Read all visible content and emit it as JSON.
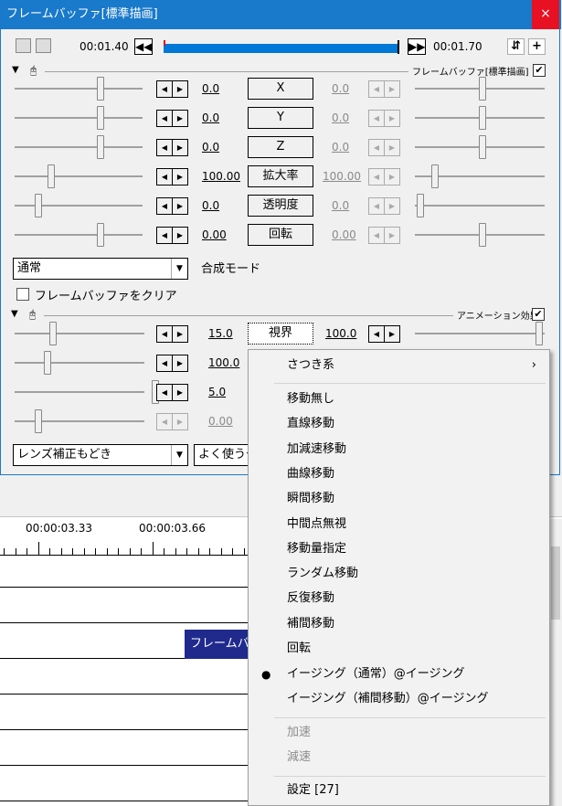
{
  "window": {
    "title": "フレームバッファ[標準描画]",
    "close_glyph": "×"
  },
  "toolbar": {
    "current_time": "00:01.40",
    "end_time": "00:01.70",
    "prev_glyph": "◀◀",
    "next_glyph": "▶▶",
    "right_btn1": "⇵",
    "right_btn2": "+"
  },
  "section1": {
    "label": "フレームバッファ[標準描画]",
    "checked": "✔"
  },
  "params": [
    {
      "left": "0.0",
      "button": "X",
      "right": "0.0"
    },
    {
      "left": "0.0",
      "button": "Y",
      "right": "0.0"
    },
    {
      "left": "0.0",
      "button": "Z",
      "right": "0.0"
    },
    {
      "left": "100.00",
      "button": "拡大率",
      "right": "100.00"
    },
    {
      "left": "0.0",
      "button": "透明度",
      "right": "0.0"
    },
    {
      "left": "0.00",
      "button": "回転",
      "right": "0.00"
    }
  ],
  "blend": {
    "value": "通常",
    "label": "合成モード"
  },
  "clear_buffer": {
    "label": "フレームバッファをクリア"
  },
  "section2": {
    "label": "アニメーション効果",
    "checked": "✔"
  },
  "anim_params": [
    {
      "left": "15.0",
      "button": "視界",
      "right": "100.0"
    },
    {
      "left": "100.0"
    },
    {
      "left": "5.0"
    },
    {
      "left": "0.00"
    }
  ],
  "anim_select": {
    "value": "レンズ補正もどき",
    "secondary": "よく使うや"
  },
  "timeline": {
    "times": [
      "00:00:03.33",
      "00:00:03.66"
    ],
    "clip": "フレームバッファ"
  },
  "context_menu": {
    "submenu": "さつき系",
    "submenu_arrow": "›",
    "items": [
      "移動無し",
      "直線移動",
      "加減速移動",
      "曲線移動",
      "瞬間移動",
      "中間点無視",
      "移動量指定",
      "ランダム移動",
      "反復移動",
      "補間移動",
      "回転"
    ],
    "checked_item": "イージング（通常）@イージング",
    "bullet": "●",
    "item_after": "イージング（補間移動）@イージング",
    "disabled": [
      "加速",
      "減速"
    ],
    "settings": "設定 [27]"
  }
}
